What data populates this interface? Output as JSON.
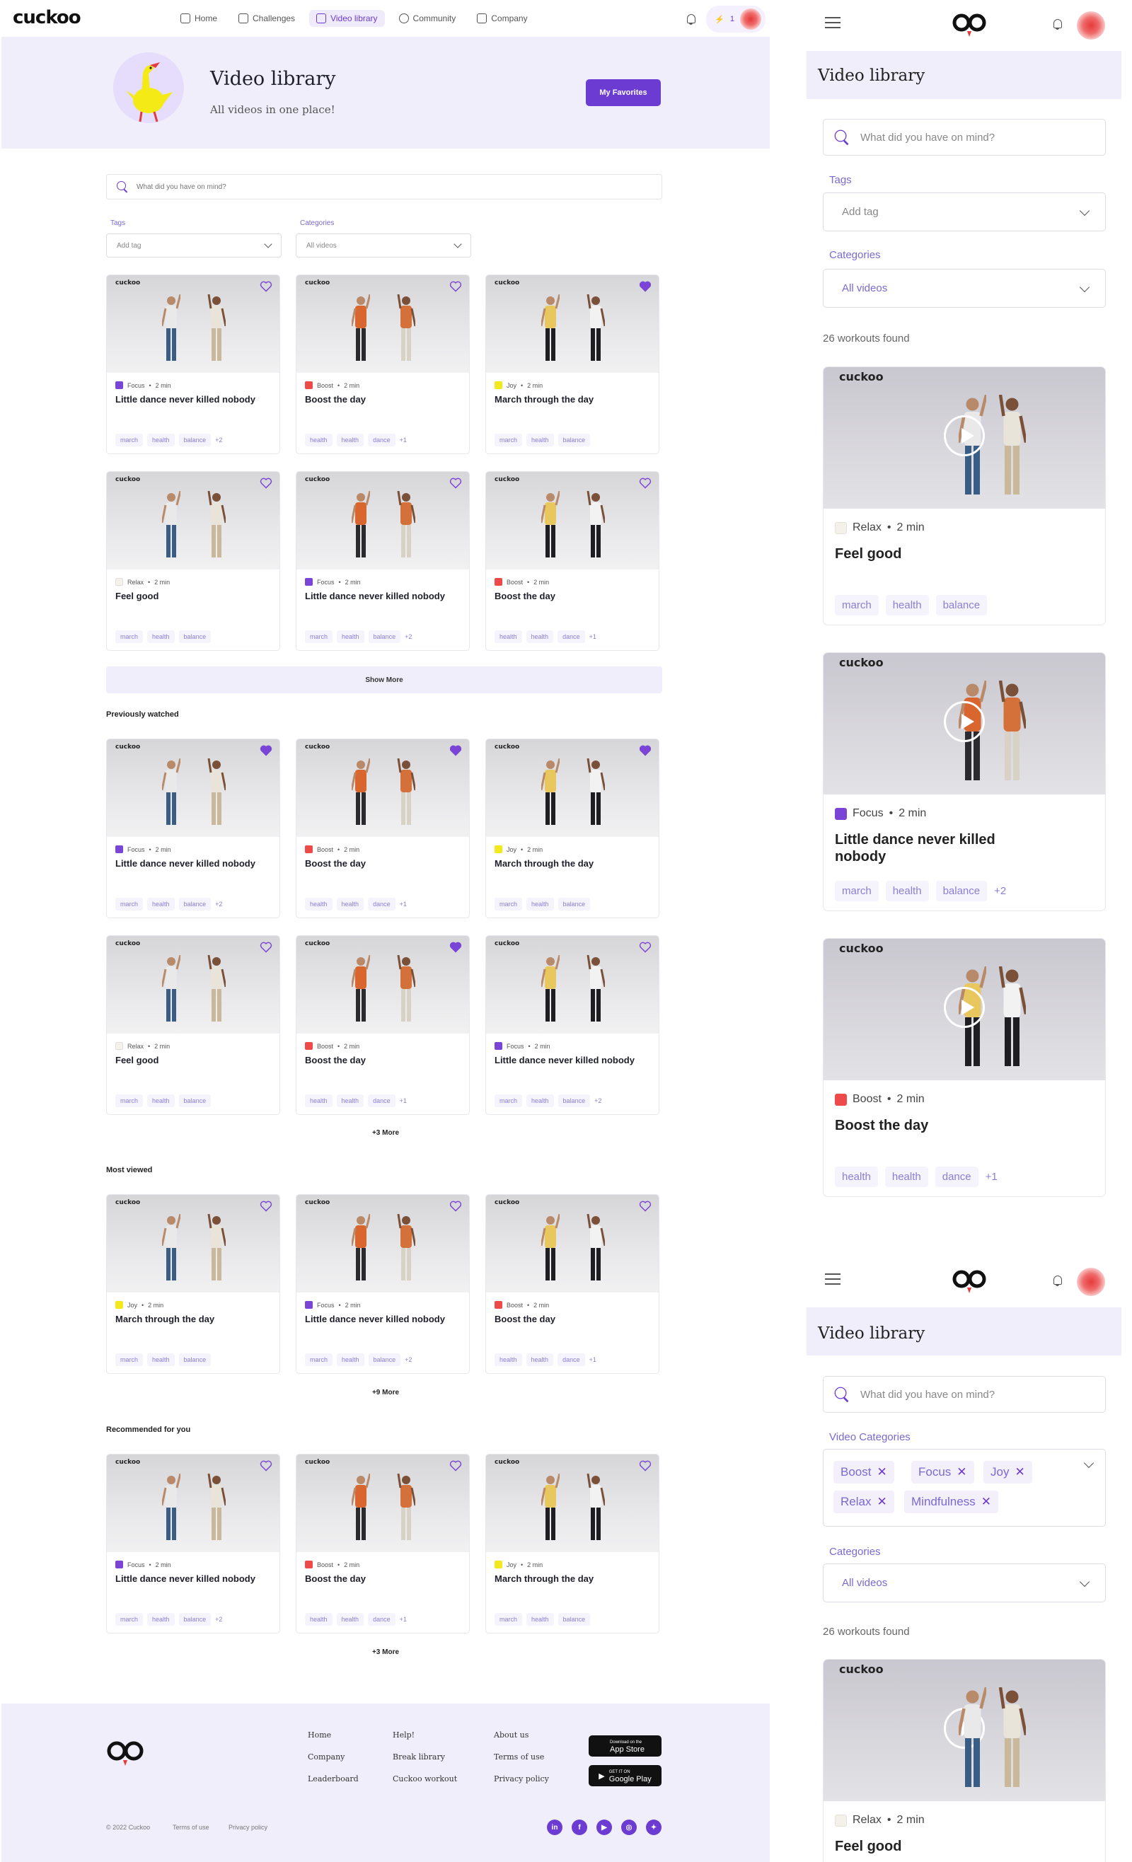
{
  "desktop": {
    "logo": "cuckoo",
    "nav": [
      {
        "label": "Home",
        "icon": "home-icon"
      },
      {
        "label": "Challenges",
        "icon": "challenges-icon"
      },
      {
        "label": "Video library",
        "icon": "video-icon"
      },
      {
        "label": "Community",
        "icon": "community-icon"
      },
      {
        "label": "Company",
        "icon": "company-icon"
      }
    ],
    "streak_count": "1",
    "hero": {
      "title": "Video library",
      "subtitle": "All videos in one place!",
      "button": "My Favorites"
    },
    "search_placeholder": "What did you have on mind?",
    "tags_label": "Tags",
    "tags_value": "Add tag",
    "categories_label": "Categories",
    "categories_value": "All videos",
    "brand": "cuckoo",
    "cards": [
      {
        "cat": "Focus",
        "color": "#7a45d6",
        "dur": "2 min",
        "title": "Little dance never killed nobody",
        "tags": [
          "march",
          "health",
          "balance"
        ],
        "extra": "+2",
        "fav": false
      },
      {
        "cat": "Boost",
        "color": "#ef4a4a",
        "dur": "2 min",
        "title": "Boost the day",
        "tags": [
          "health",
          "health",
          "dance"
        ],
        "extra": "+1",
        "fav": false
      },
      {
        "cat": "Joy",
        "color": "#f3e81b",
        "dur": "2 min",
        "title": "March through the day",
        "tags": [
          "march",
          "health",
          "balance"
        ],
        "extra": "",
        "fav": true
      },
      {
        "cat": "Relax",
        "color": "#f3f1ea",
        "dur": "2 min",
        "title": "Feel good",
        "tags": [
          "march",
          "health",
          "balance"
        ],
        "extra": "",
        "fav": false
      },
      {
        "cat": "Focus",
        "color": "#7a45d6",
        "dur": "2 min",
        "title": "Little dance never killed nobody",
        "tags": [
          "march",
          "health",
          "balance"
        ],
        "extra": "+2",
        "fav": false
      },
      {
        "cat": "Boost",
        "color": "#ef4a4a",
        "dur": "2 min",
        "title": "Boost the day",
        "tags": [
          "health",
          "health",
          "dance"
        ],
        "extra": "+1",
        "fav": false
      }
    ],
    "show_more": "Show More",
    "previously_watched": {
      "title": "Previously watched",
      "more": "+3 More",
      "cards": [
        {
          "cat": "Focus",
          "color": "#7a45d6",
          "dur": "2 min",
          "title": "Little dance never killed nobody",
          "tags": [
            "march",
            "health",
            "balance"
          ],
          "extra": "+2",
          "fav": true
        },
        {
          "cat": "Boost",
          "color": "#ef4a4a",
          "dur": "2 min",
          "title": "Boost the day",
          "tags": [
            "health",
            "health",
            "dance"
          ],
          "extra": "+1",
          "fav": true
        },
        {
          "cat": "Joy",
          "color": "#f3e81b",
          "dur": "2 min",
          "title": "March through the day",
          "tags": [
            "march",
            "health",
            "balance"
          ],
          "extra": "",
          "fav": true
        },
        {
          "cat": "Relax",
          "color": "#f3f1ea",
          "dur": "2 min",
          "title": "Feel good",
          "tags": [
            "march",
            "health",
            "balance"
          ],
          "extra": "",
          "fav": false
        },
        {
          "cat": "Boost",
          "color": "#ef4a4a",
          "dur": "2 min",
          "title": "Boost the day",
          "tags": [
            "health",
            "health",
            "dance"
          ],
          "extra": "+1",
          "fav": true
        },
        {
          "cat": "Focus",
          "color": "#7a45d6",
          "dur": "2 min",
          "title": "Little dance never killed nobody",
          "tags": [
            "march",
            "health",
            "balance"
          ],
          "extra": "+2",
          "fav": false
        }
      ]
    },
    "most_viewed": {
      "title": "Most viewed",
      "more": "+9 More",
      "cards": [
        {
          "cat": "Joy",
          "color": "#f3e81b",
          "dur": "2 min",
          "title": "March through the day",
          "tags": [
            "march",
            "health",
            "balance"
          ],
          "extra": "",
          "fav": false
        },
        {
          "cat": "Focus",
          "color": "#7a45d6",
          "dur": "2 min",
          "title": "Little dance never killed nobody",
          "tags": [
            "march",
            "health",
            "balance"
          ],
          "extra": "+2",
          "fav": false
        },
        {
          "cat": "Boost",
          "color": "#ef4a4a",
          "dur": "2 min",
          "title": "Boost the day",
          "tags": [
            "health",
            "health",
            "dance"
          ],
          "extra": "+1",
          "fav": false
        }
      ]
    },
    "recommended": {
      "title": "Recommended for you",
      "more": "+3 More",
      "cards": [
        {
          "cat": "Focus",
          "color": "#7a45d6",
          "dur": "2 min",
          "title": "Little dance never killed nobody",
          "tags": [
            "march",
            "health",
            "balance"
          ],
          "extra": "+2",
          "fav": false
        },
        {
          "cat": "Boost",
          "color": "#ef4a4a",
          "dur": "2 min",
          "title": "Boost the day",
          "tags": [
            "health",
            "health",
            "dance"
          ],
          "extra": "+1",
          "fav": false
        },
        {
          "cat": "Joy",
          "color": "#f3e81b",
          "dur": "2 min",
          "title": "March through the day",
          "tags": [
            "march",
            "health",
            "balance"
          ],
          "extra": "",
          "fav": false
        }
      ]
    },
    "footer": {
      "col1": [
        "Home",
        "Company",
        "Leaderboard"
      ],
      "col2": [
        "Help!",
        "Break library",
        "Cuckoo workout"
      ],
      "col3": [
        "About us",
        "Terms of use",
        "Privacy policy"
      ],
      "app_store": "App Store",
      "app_store_small": "Download on the",
      "google_play": "Google Play",
      "google_play_small": "GET IT ON",
      "copyright": "© 2022 Cuckoo",
      "terms": "Terms of use",
      "privacy": "Privacy policy",
      "social": [
        "linkedin-icon",
        "facebook-icon",
        "youtube-icon",
        "instagram-icon",
        "twitter-icon"
      ]
    }
  },
  "mobile1": {
    "title": "Video library",
    "search_placeholder": "What did you have on mind?",
    "tags_label": "Tags",
    "tags_value": "Add tag",
    "categories_label": "Categories",
    "categories_value": "All videos",
    "found": "26 workouts found",
    "brand": "cuckoo",
    "cards": [
      {
        "cat": "Relax",
        "color": "#f3f1ea",
        "dur": "2 min",
        "title": "Feel good",
        "tags": [
          "march",
          "health",
          "balance"
        ],
        "extra": ""
      },
      {
        "cat": "Focus",
        "color": "#7a45d6",
        "dur": "2 min",
        "title": "Little dance never killed nobody",
        "tags": [
          "march",
          "health",
          "balance"
        ],
        "extra": "+2"
      },
      {
        "cat": "Boost",
        "color": "#ef4a4a",
        "dur": "2 min",
        "title": "Boost the day",
        "tags": [
          "health",
          "health",
          "dance"
        ],
        "extra": "+1"
      }
    ]
  },
  "mobile2": {
    "title": "Video library",
    "search_placeholder": "What did you have on mind?",
    "video_categories_label": "Video Categories",
    "chips": [
      "Boost",
      "Focus",
      "Joy",
      "Relax",
      "Mindfulness"
    ],
    "categories_label": "Categories",
    "categories_value": "All videos",
    "found": "26 workouts found",
    "brand": "cuckoo",
    "card": {
      "cat": "Relax",
      "color": "#f3f1ea",
      "dur": "2 min",
      "title": "Feel good"
    }
  }
}
